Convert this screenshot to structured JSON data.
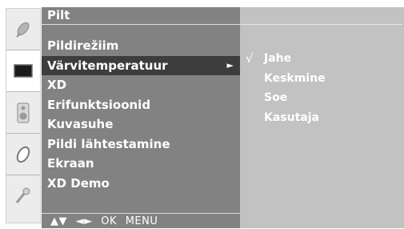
{
  "menu": {
    "title": "Pilt",
    "items": [
      {
        "label": "Pildirežiim",
        "selected": false
      },
      {
        "label": "Värvitemperatuur",
        "selected": true,
        "arrow": "►"
      },
      {
        "label": "XD",
        "selected": false
      },
      {
        "label": "Erifunktsioonid",
        "selected": false
      },
      {
        "label": "Kuvasuhe",
        "selected": false
      },
      {
        "label": "Pildi lähtestamine",
        "selected": false
      },
      {
        "label": "Ekraan",
        "selected": false
      },
      {
        "label": "XD Demo",
        "selected": false
      }
    ],
    "nav": {
      "updown": "▲▼",
      "leftright": "◄►",
      "ok": "OK",
      "menu": "MENU"
    }
  },
  "submenu": {
    "check_mark": "√",
    "items": [
      {
        "label": "Jahe",
        "checked": true
      },
      {
        "label": "Keskmine",
        "checked": false
      },
      {
        "label": "Soe",
        "checked": false
      },
      {
        "label": "Kasutaja",
        "checked": false
      }
    ]
  },
  "icons": [
    {
      "name": "satellite-dish-icon",
      "active": false
    },
    {
      "name": "tv-screen-icon",
      "active": true
    },
    {
      "name": "speaker-icon",
      "active": false
    },
    {
      "name": "clock-icon",
      "active": false
    },
    {
      "name": "key-icon",
      "active": false
    }
  ],
  "colors": {
    "menu_bg": "#828282",
    "selected_bg": "#3d3d3d",
    "submenu_bg": "#c2c2c2",
    "text": "#ffffff"
  }
}
